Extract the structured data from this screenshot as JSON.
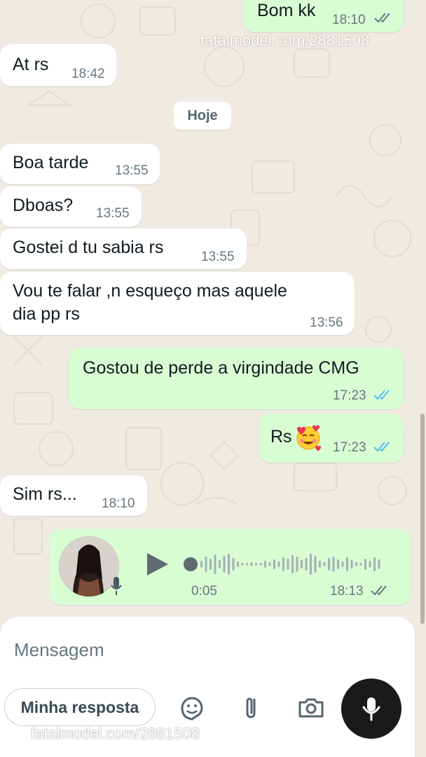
{
  "colors": {
    "wallpaper": "#efeae2",
    "incoming_bubble": "#ffffff",
    "outgoing_bubble": "#d9fdd3",
    "read_ticks": "#53bdeb",
    "sent_ticks": "#667781",
    "mic_button": "#1a1a1a"
  },
  "watermark": {
    "top": "fatalmodel.com/2881508",
    "bottom": "fatalmodel.com/2881508"
  },
  "date_separator": "Hoje",
  "messages": [
    {
      "direction": "out",
      "text": "Bom kk",
      "time": "18:10",
      "status": "delivered"
    },
    {
      "direction": "in",
      "text": "At rs",
      "time": "18:42"
    },
    {
      "direction": "in",
      "text": "Boa tarde",
      "time": "13:55"
    },
    {
      "direction": "in",
      "text": "Dboas?",
      "time": "13:55"
    },
    {
      "direction": "in",
      "text": "Gostei d tu sabia rs",
      "time": "13:55"
    },
    {
      "direction": "in",
      "text": "Vou te falar ,n esqueço mas aquele",
      "text2": "dia pp rs",
      "time": "13:56"
    },
    {
      "direction": "out",
      "text": "Gostou de perde a virgindade CMG",
      "time": "17:23",
      "status": "read"
    },
    {
      "direction": "out",
      "text": "Rs",
      "emoji": "smiling-face-with-hearts",
      "time": "17:23",
      "status": "read"
    },
    {
      "direction": "in",
      "text": "Sim rs...",
      "time": "18:10"
    }
  ],
  "voice_note": {
    "direction": "out",
    "duration": "0:05",
    "time": "18:13",
    "status": "delivered",
    "progress": 0.0
  },
  "composer": {
    "placeholder": "Mensagem",
    "quick_reply": "Minha resposta",
    "icons": [
      "sticker-icon",
      "attachment-icon",
      "camera-icon",
      "mic-icon"
    ]
  }
}
